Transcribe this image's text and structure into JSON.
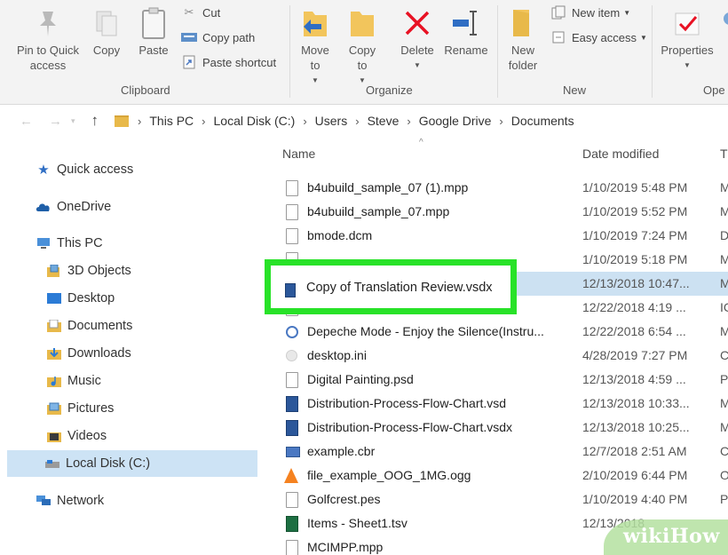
{
  "ribbon": {
    "clipboard": {
      "pin_label": "Pin to Quick access",
      "copy_label": "Copy",
      "paste_label": "Paste",
      "cut_label": "Cut",
      "copy_path_label": "Copy path",
      "paste_shortcut_label": "Paste shortcut",
      "group_label": "Clipboard"
    },
    "organize": {
      "move_to_label": "Move to",
      "copy_to_label": "Copy to",
      "delete_label": "Delete",
      "rename_label": "Rename",
      "group_label": "Organize"
    },
    "new": {
      "new_folder_label": "New folder",
      "new_item_label": "New item",
      "easy_access_label": "Easy access",
      "group_label": "New"
    },
    "open": {
      "properties_label": "Properties",
      "group_label": "Ope"
    }
  },
  "address": {
    "crumbs": [
      "This PC",
      "Local Disk (C:)",
      "Users",
      "Steve",
      "Google Drive",
      "Documents"
    ]
  },
  "navpane": {
    "quick_access": "Quick access",
    "onedrive": "OneDrive",
    "this_pc": "This PC",
    "objects_3d": "3D Objects",
    "desktop": "Desktop",
    "documents": "Documents",
    "downloads": "Downloads",
    "music": "Music",
    "pictures": "Pictures",
    "videos": "Videos",
    "local_disk": "Local Disk (C:)",
    "network": "Network"
  },
  "filelist": {
    "columns": {
      "name": "Name",
      "date": "Date modified",
      "type": "T"
    },
    "rows": [
      {
        "name": "b4ubuild_sample_07 (1).mpp",
        "date": "1/10/2019 5:48 PM",
        "type": "M",
        "icon": "doc"
      },
      {
        "name": "b4ubuild_sample_07.mpp",
        "date": "1/10/2019 5:52 PM",
        "type": "M",
        "icon": "doc"
      },
      {
        "name": "bmode.dcm",
        "date": "1/10/2019 7:24 PM",
        "type": "D",
        "icon": "doc"
      },
      {
        "name": "",
        "date": "1/10/2019 5:18 PM",
        "type": "M",
        "icon": "doc"
      },
      {
        "name": "Copy of Translation Review.vsdx",
        "date": "12/13/2018 10:47...",
        "type": "M",
        "icon": "visio"
      },
      {
        "name": "",
        "date": "12/22/2018 4:19 ...",
        "type": "IC",
        "icon": "doc"
      },
      {
        "name": "Depeche Mode - Enjoy the Silence(Instru...",
        "date": "12/22/2018 6:54 ...",
        "type": "M",
        "icon": "media"
      },
      {
        "name": "desktop.ini",
        "date": "4/28/2019 7:27 PM",
        "type": "C",
        "icon": "gear"
      },
      {
        "name": "Digital Painting.psd",
        "date": "12/13/2018 4:59 ...",
        "type": "P",
        "icon": "doc"
      },
      {
        "name": "Distribution-Process-Flow-Chart.vsd",
        "date": "12/13/2018 10:33...",
        "type": "M",
        "icon": "visio"
      },
      {
        "name": "Distribution-Process-Flow-Chart.vsdx",
        "date": "12/13/2018 10:25...",
        "type": "M",
        "icon": "visio"
      },
      {
        "name": "example.cbr",
        "date": "12/7/2018 2:51 AM",
        "type": "C",
        "icon": "cbr"
      },
      {
        "name": "file_example_OOG_1MG.ogg",
        "date": "2/10/2019 6:44 PM",
        "type": "O",
        "icon": "vlc"
      },
      {
        "name": "Golfcrest.pes",
        "date": "1/10/2019 4:40 PM",
        "type": "P",
        "icon": "doc"
      },
      {
        "name": "Items - Sheet1.tsv",
        "date": "12/13/2018",
        "type": "",
        "icon": "excel"
      },
      {
        "name": "MCIMPP.mpp",
        "date": "",
        "type": "",
        "icon": "doc"
      }
    ],
    "highlighted_name": "Copy of Translation Review.vsdx"
  },
  "watermark": {
    "text": "wikiHow"
  },
  "colors": {
    "highlight_green": "#28e228",
    "selection_blue": "#cce1f2",
    "ribbon_bg": "#f3f3f3",
    "folder_yellow": "#e8b94a",
    "delete_red": "#e81123"
  }
}
